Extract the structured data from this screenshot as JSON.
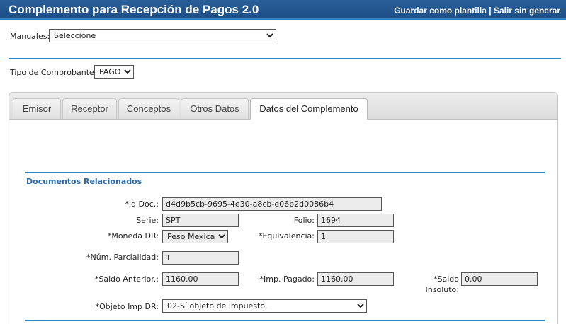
{
  "header": {
    "title": "Complemento para Recepción de Pagos  2.0",
    "save_template": "Guardar como plantilla",
    "separator": "|",
    "exit": "Salir sin generar"
  },
  "manuales": {
    "label": "Manuales:",
    "value": "Seleccione"
  },
  "tipo_comprobante": {
    "label": "Tipo de Comprobante:",
    "value": "PAGO"
  },
  "tabs": [
    {
      "label": "Emisor"
    },
    {
      "label": "Receptor"
    },
    {
      "label": "Conceptos"
    },
    {
      "label": "Otros Datos"
    },
    {
      "label": "Datos del Complemento",
      "active": true
    }
  ],
  "section": {
    "title": "Documentos Relacionados"
  },
  "form": {
    "id_doc": {
      "label": "*Id Doc.:",
      "value": "d4d9b5cb-9695-4e30-a8cb-e06b2d0086b4"
    },
    "serie": {
      "label": "Serie:",
      "value": "SPT"
    },
    "folio": {
      "label": "Folio:",
      "value": "1694"
    },
    "moneda": {
      "label": "*Moneda DR:",
      "value": "Peso Mexicano"
    },
    "equivalencia": {
      "label": "*Equivalencia:",
      "value": "1"
    },
    "num_parcialidad": {
      "label": "*Núm. Parcialidad:",
      "value": "1"
    },
    "saldo_anterior": {
      "label": "*Saldo Anterior.:",
      "value": "1160.00"
    },
    "imp_pagado": {
      "label": "*Imp. Pagado:",
      "value": "1160.00"
    },
    "saldo_insoluto": {
      "label_line1": "*Saldo",
      "label_line2": "Insoluto:",
      "value": "0.00"
    },
    "objeto_imp": {
      "label": "*Objeto Imp DR:",
      "value": "02-Sí objeto de impuesto."
    }
  },
  "colors": {
    "header_bg": "#1d4e86",
    "accent_line": "#2c87c6",
    "section_title": "#2b6aa8"
  }
}
